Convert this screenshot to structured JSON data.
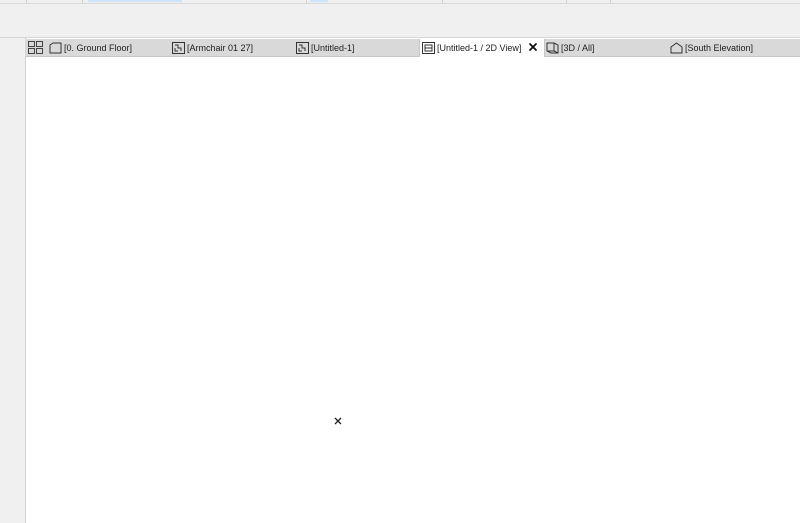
{
  "tabs": [
    {
      "label": "[0. Ground Floor]",
      "icon": "floor-plan-icon",
      "active": false
    },
    {
      "label": "[Armchair 01 27]",
      "icon": "section-view-icon",
      "active": false
    },
    {
      "label": "[Untitled-1]",
      "icon": "section-view-icon",
      "active": false
    },
    {
      "label": "[Untitled-1 / 2D View]",
      "icon": "2d-view-icon",
      "active": true
    },
    {
      "label": "[3D / All]",
      "icon": "3d-view-icon",
      "active": false
    },
    {
      "label": "[South Elevation]",
      "icon": "elevation-icon",
      "active": false
    }
  ],
  "overview_button": {
    "icon": "tab-overview-grid-icon"
  },
  "active_tab_close": {
    "icon": "close-icon"
  },
  "canvas": {
    "origin_icon": "origin-cross-icon"
  }
}
